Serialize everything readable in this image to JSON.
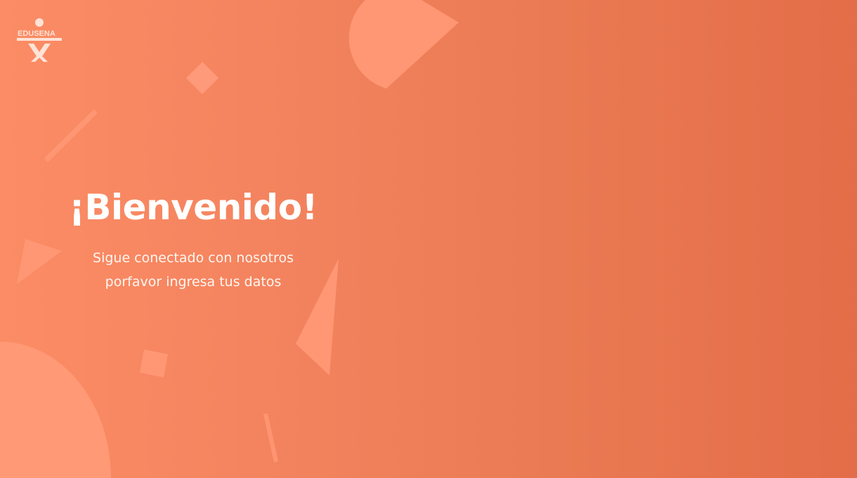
{
  "brand": {
    "logo_text": "EDUSENA"
  },
  "welcome": {
    "title": "¡Bienvenido!",
    "subtitle_line1": "Sigue conectado con nosotros",
    "subtitle_line2": "porfavor ingresa tus datos"
  },
  "colors": {
    "background_start": "#fb8c65",
    "background_end": "#e36d48",
    "shape_fill": "#ff9876",
    "text": "#ffffff"
  }
}
